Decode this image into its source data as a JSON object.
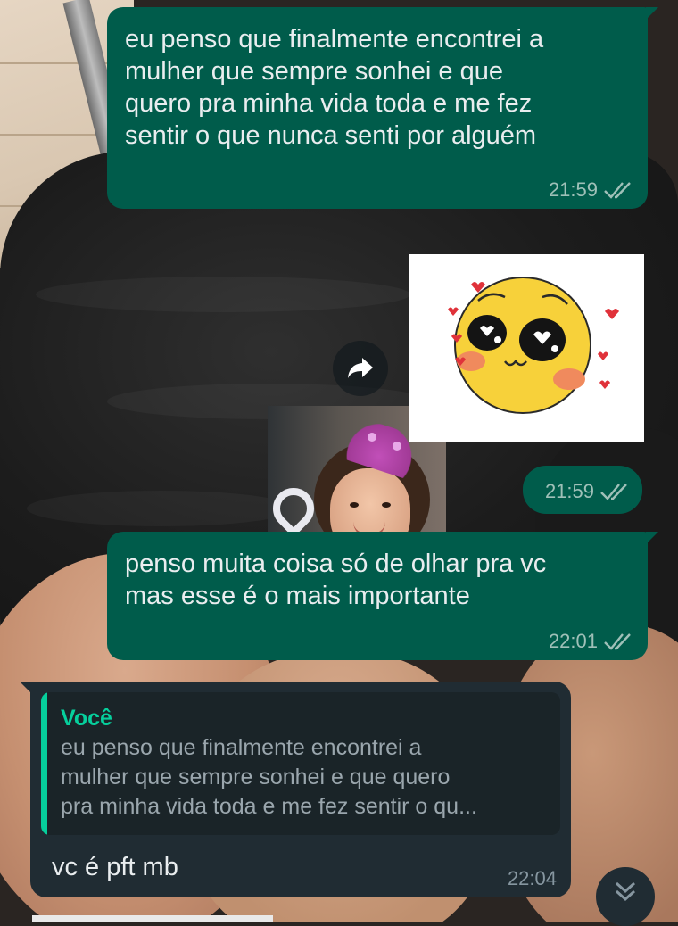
{
  "messages": [
    {
      "direction": "outgoing",
      "text_lines": [
        "eu penso que finalmente encontrei a",
        "mulher que sempre sonhei e que",
        "quero pra minha vida toda e me fez",
        "sentir o que nunca senti por alguém"
      ],
      "time": "21:59",
      "status": "read"
    },
    {
      "direction": "outgoing",
      "type": "sticker",
      "sticker_icon": "blushing-pleading-face-sticker",
      "time": "21:59",
      "status": "read"
    },
    {
      "direction": "outgoing",
      "text_lines": [
        "penso muita coisa só de olhar pra vc",
        "mas esse é o mais importante"
      ],
      "time": "22:01",
      "status": "read"
    },
    {
      "direction": "incoming",
      "quote": {
        "author": "Você",
        "text_lines": [
          "eu penso que finalmente encontrei a",
          "mulher que sempre sonhei e que quero",
          "pra minha vida toda e me fez sentir o qu..."
        ]
      },
      "text": "vc é pft mb",
      "time": "22:04"
    }
  ],
  "icons": {
    "forward": "forward-arrow-icon",
    "scroll_down": "double-chevron-down-icon",
    "read_receipt": "double-check-icon"
  },
  "colors": {
    "outgoing_bubble": "#005c4b",
    "incoming_bubble": "#202c33",
    "quote_accent": "#06cf9c",
    "text": "#e9edef"
  }
}
